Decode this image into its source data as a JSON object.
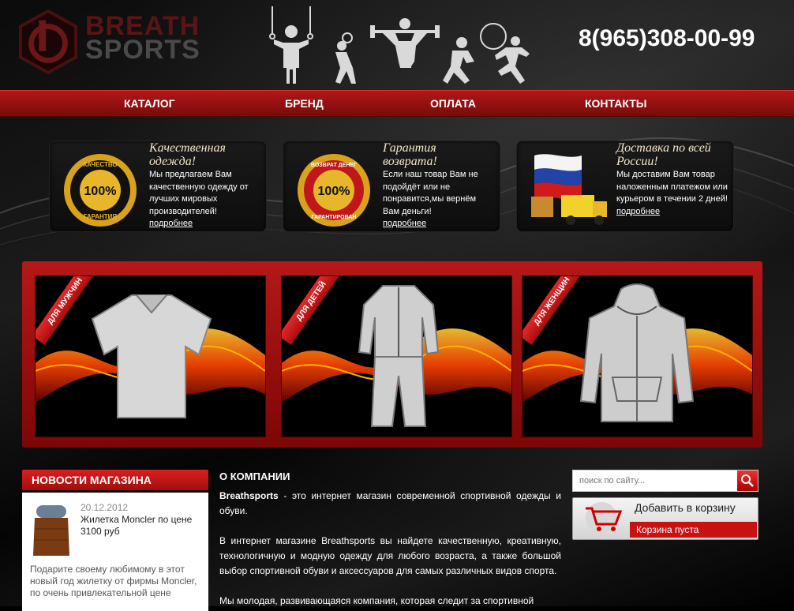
{
  "header": {
    "logo_line1": "BREATH",
    "logo_line2": "SPORTS",
    "phone": "8(965)308-00-99"
  },
  "nav": {
    "items": [
      "КАТАЛОГ",
      "БРЕНД",
      "ОПЛАТА",
      "КОНТАКТЫ"
    ]
  },
  "features": [
    {
      "title": "Качественная одежда!",
      "text": "Мы предлагаем Вам качественную одежду от лучших мировых производителей!",
      "more": "подробнее",
      "icon": "quality-100-badge-icon",
      "seal_lines": [
        "КАЧЕСТВО",
        "100%",
        "ГАРАНТИЯ"
      ]
    },
    {
      "title": "Гарантия возврата!",
      "text": "Если наш товар Вам не подойдёт или не понравится,мы вернём Вам деньги!",
      "more": "подробнее",
      "icon": "money-back-guarantee-icon",
      "seal_lines": [
        "ВОЗВРАТ ДЕНЕГ",
        "100%",
        "ГАРАНТИРОВАН"
      ]
    },
    {
      "title": "Доставка по всей России!",
      "text": "Мы доставим Вам товар наложенным платежом или курьером в течении 2 дней!",
      "more": "подробнее",
      "icon": "russia-flag-delivery-truck-icon"
    }
  ],
  "categories": [
    {
      "label": "ДЛЯ МУЖЧИН",
      "item": "polo-shirt"
    },
    {
      "label": "ДЛЯ ДЕТЕЙ",
      "item": "tracksuit"
    },
    {
      "label": "ДЛЯ ЖЕНЩИН",
      "item": "hoodie"
    }
  ],
  "news": {
    "header": "НОВОСТИ МАГАЗИНА",
    "date": "20.12.2012",
    "title": "Жилетка Moncler по цене 3100 руб",
    "text": "Подарите своему любимому в этот новый год жилетку от фирмы Moncler, по очень привлекательной цене"
  },
  "about": {
    "title": "О КОМПАНИИ",
    "p1_bold": "Breathsports",
    "p1_rest": " - это интернет магазин современной спортивной одежды и обуви.",
    "p2": "В интернет магазине Breathsports вы найдете качественную, креативную, технологичную и модную одежду для любого возраста, а также большой выбор спортивной обуви и аксессуаров для самых различных видов спорта.",
    "p3": "Мы молодая, развивающаяся компания, которая следит за спортивной"
  },
  "sidebar": {
    "search_placeholder": "поиск по сайту...",
    "cart_add": "Добавить в корзину",
    "cart_empty": "Корзина пуста"
  },
  "colors": {
    "accent": "#c81212",
    "nav": "#a01010"
  }
}
